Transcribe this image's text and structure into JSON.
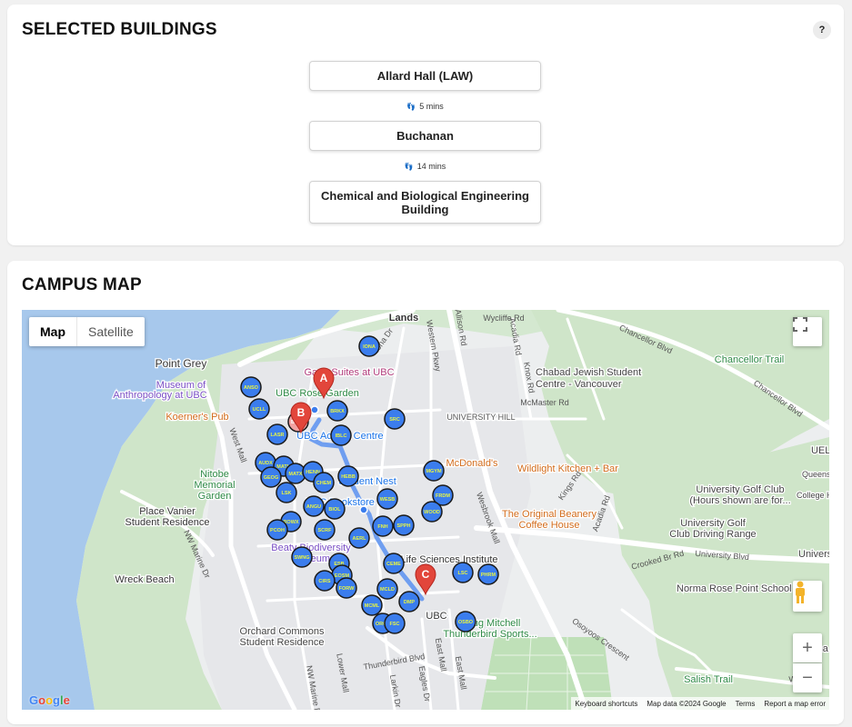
{
  "selected": {
    "title": "SELECTED BUILDINGS",
    "help": "?",
    "buildings": [
      {
        "name": "Allard Hall (LAW)"
      },
      {
        "name": "Buchanan"
      },
      {
        "name": "Chemical and Biological Engineering Building"
      }
    ],
    "walks": [
      "5 mins",
      "14 mins"
    ]
  },
  "map_section": {
    "title": "CAMPUS MAP",
    "maptype": {
      "map": "Map",
      "satellite": "Satellite"
    },
    "zoom_in": "+",
    "zoom_out": "−",
    "attribution": [
      "Keyboard shortcuts",
      "Map data ©2024 Google",
      "Terms",
      "Report a map error"
    ],
    "logo": "Google",
    "colors": {
      "water": "#a7c8ec",
      "park": "#cfe8cf",
      "land": "#eceeef",
      "route": "#6f9ef0",
      "marker_blue": "#3b7ded",
      "pin_red": "#e2463b"
    },
    "markers": [
      {
        "code": "IONA"
      },
      {
        "code": "ANSO"
      },
      {
        "code": "UCLL"
      },
      {
        "code": "BRKX"
      },
      {
        "code": "SRC"
      },
      {
        "code": "LASR"
      },
      {
        "code": "IBLC"
      },
      {
        "code": "AUDX"
      },
      {
        "code": "MATH"
      },
      {
        "code": "MATX"
      },
      {
        "code": "HENN"
      },
      {
        "code": "GEOG"
      },
      {
        "code": "CHEM"
      },
      {
        "code": "HEBB"
      },
      {
        "code": "LSK"
      },
      {
        "code": "MGYM"
      },
      {
        "code": "FRDM"
      },
      {
        "code": "ANGU"
      },
      {
        "code": "BIOL"
      },
      {
        "code": "WESB"
      },
      {
        "code": "WOOD"
      },
      {
        "code": "ROWX"
      },
      {
        "code": "PCOH"
      },
      {
        "code": "SCRF"
      },
      {
        "code": "FNH"
      },
      {
        "code": "SPPH"
      },
      {
        "code": "AERL"
      },
      {
        "code": "SWNG"
      },
      {
        "code": "ESB"
      },
      {
        "code": "CEME"
      },
      {
        "code": "EOSM"
      },
      {
        "code": "CIRS"
      },
      {
        "code": "FORW"
      },
      {
        "code": "MCLD"
      },
      {
        "code": "LSC"
      },
      {
        "code": "PHRM"
      },
      {
        "code": "MCML"
      },
      {
        "code": "DMP"
      },
      {
        "code": "ORCH"
      },
      {
        "code": "FSC"
      },
      {
        "code": "OSBO"
      },
      {
        "code": "BUCH"
      }
    ],
    "pins": [
      "A",
      "B",
      "C"
    ],
    "place_labels": [
      {
        "text": "Lands"
      },
      {
        "text": "Point Grey"
      },
      {
        "text": "Museum of"
      },
      {
        "text": "Anthropology at UBC"
      },
      {
        "text": "UBC Rose Garden"
      },
      {
        "text": "Koerner's Pub"
      },
      {
        "text": "Gage Suites at UBC"
      },
      {
        "text": "UBC Acadia Centre"
      },
      {
        "text": "Chabad Jewish Student"
      },
      {
        "text": "Centre - Vancouver"
      },
      {
        "text": "UNIVERSITY HILL"
      },
      {
        "text": "McDonald's"
      },
      {
        "text": "Wildlight Kitchen + Bar"
      },
      {
        "text": "Nitobe"
      },
      {
        "text": "Memorial"
      },
      {
        "text": "Garden"
      },
      {
        "text": "Student Nest"
      },
      {
        "text": "UBC Bookstore"
      },
      {
        "text": "Place Vanier"
      },
      {
        "text": "Student Residence"
      },
      {
        "text": "Beaty Biodiversity"
      },
      {
        "text": "Museum"
      },
      {
        "text": "The Original Beanery"
      },
      {
        "text": "Coffee House"
      },
      {
        "text": "Life Sciences Institute"
      },
      {
        "text": "Wreck Beach"
      },
      {
        "text": "Orchard Commons"
      },
      {
        "text": "Student Residence"
      },
      {
        "text": "UBC"
      },
      {
        "text": "Doug Mitchell"
      },
      {
        "text": "Thunderbird Sports..."
      },
      {
        "text": "University Golf Club"
      },
      {
        "text": "(Hours shown are for..."
      },
      {
        "text": "University Golf"
      },
      {
        "text": "Club Driving Range"
      },
      {
        "text": "Norma Rose Point School"
      },
      {
        "text": "Chancellor Trail"
      },
      {
        "text": "Salish Trail"
      },
      {
        "text": "Regina"
      },
      {
        "text": "UEL"
      },
      {
        "text": "Queens"
      },
      {
        "text": "College H"
      },
      {
        "text": "Universi"
      }
    ],
    "street_labels": [
      {
        "text": "Chancellor Blvd"
      },
      {
        "text": "Chancellor Blvd"
      },
      {
        "text": "Wycliffe Rd"
      },
      {
        "text": "Western Pkwy"
      },
      {
        "text": "Allison Rd"
      },
      {
        "text": "Acadia Rd"
      },
      {
        "text": "Knox Rd"
      },
      {
        "text": "McMaster Rd"
      },
      {
        "text": "Wesbrook Mall"
      },
      {
        "text": "West Mall"
      },
      {
        "text": "NW Marine Dr"
      },
      {
        "text": "NW Marine Dr"
      },
      {
        "text": "Kings Rd"
      },
      {
        "text": "Acadia Rd"
      },
      {
        "text": "University Blvd"
      },
      {
        "text": "Crooked Br Rd"
      },
      {
        "text": "Osoyoos Crescent"
      },
      {
        "text": "Thunderbird Blvd"
      },
      {
        "text": "Eagles Dr"
      },
      {
        "text": "East Mall"
      },
      {
        "text": "Larkin Dr"
      },
      {
        "text": "W 16th A"
      },
      {
        "text": "Iona Dr"
      },
      {
        "text": "Lower Mall"
      },
      {
        "text": "East Mall"
      }
    ]
  }
}
